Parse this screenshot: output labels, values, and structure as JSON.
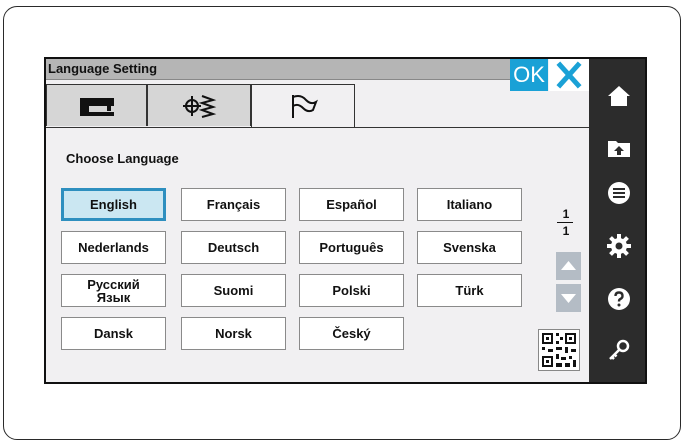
{
  "window": {
    "title": "Language Setting"
  },
  "toolbar": {
    "ok_label": "OK",
    "close_icon": "close-icon"
  },
  "tabs": [
    {
      "icon": "sewing-machine-icon",
      "active": false
    },
    {
      "icon": "stitch-pattern-icon",
      "active": false
    },
    {
      "icon": "flag-icon",
      "active": true
    }
  ],
  "content": {
    "heading": "Choose Language",
    "languages": [
      "English",
      "Français",
      "Español",
      "Italiano",
      "Nederlands",
      "Deutsch",
      "Português",
      "Svenska",
      "Русский Язык",
      "Suomi",
      "Polski",
      "Türk",
      "Dansk",
      "Norsk",
      "Český"
    ],
    "selected": "English"
  },
  "pagination": {
    "current": "1",
    "total": "1"
  },
  "sidebar": {
    "items": [
      "home-icon",
      "folder-upload-icon",
      "menu-icon",
      "gear-icon",
      "help-icon",
      "key-icon"
    ]
  },
  "colors": {
    "accent": "#1aa1d6",
    "selected_bg": "#cbe7f2",
    "sidebar": "#2c2c2c",
    "titlebar": "#b5b5b5"
  }
}
